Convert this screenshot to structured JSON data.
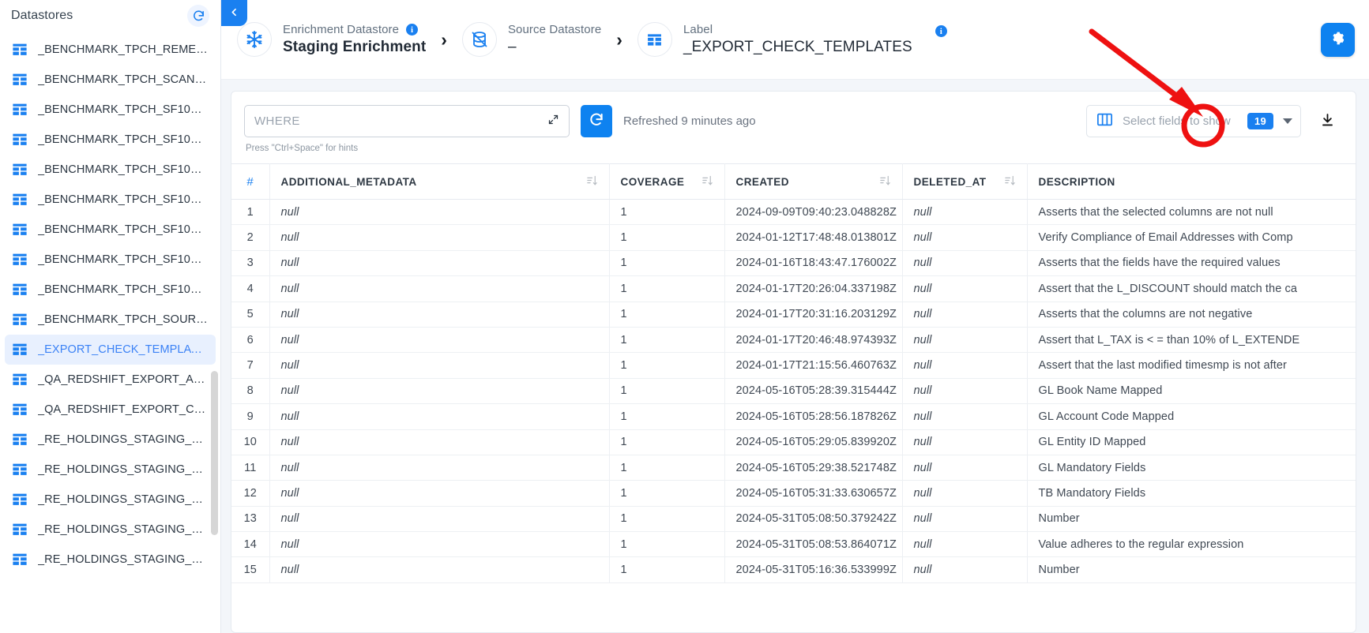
{
  "sidebar": {
    "title": "Datastores",
    "refresh_icon": "refresh-icon",
    "items": [
      {
        "label": "_BENCHMARK_TPCH_REME…",
        "icon": "table-icon",
        "active": false
      },
      {
        "label": "_BENCHMARK_TPCH_SCAN…",
        "icon": "table-icon",
        "active": false
      },
      {
        "label": "_BENCHMARK_TPCH_SF10_…",
        "icon": "table-icon",
        "active": false
      },
      {
        "label": "_BENCHMARK_TPCH_SF10_…",
        "icon": "table-icon",
        "active": false
      },
      {
        "label": "_BENCHMARK_TPCH_SF10_…",
        "icon": "table-icon",
        "active": false
      },
      {
        "label": "_BENCHMARK_TPCH_SF10_…",
        "icon": "table-icon",
        "active": false
      },
      {
        "label": "_BENCHMARK_TPCH_SF10_…",
        "icon": "table-icon",
        "active": false
      },
      {
        "label": "_BENCHMARK_TPCH_SF10_…",
        "icon": "table-icon",
        "active": false
      },
      {
        "label": "_BENCHMARK_TPCH_SF10_…",
        "icon": "table-icon",
        "active": false
      },
      {
        "label": "_BENCHMARK_TPCH_SOUR…",
        "icon": "table-icon",
        "active": false
      },
      {
        "label": "_EXPORT_CHECK_TEMPLAT…",
        "icon": "table-icon",
        "active": true
      },
      {
        "label": "_QA_REDSHIFT_EXPORT_A…",
        "icon": "table-icon",
        "active": false
      },
      {
        "label": "_QA_REDSHIFT_EXPORT_C…",
        "icon": "table-icon",
        "active": false
      },
      {
        "label": "_RE_HOLDINGS_STAGING_…",
        "icon": "table-icon",
        "active": false
      },
      {
        "label": "_RE_HOLDINGS_STAGING_…",
        "icon": "table-icon",
        "active": false
      },
      {
        "label": "_RE_HOLDINGS_STAGING_…",
        "icon": "table-icon",
        "active": false
      },
      {
        "label": "_RE_HOLDINGS_STAGING_…",
        "icon": "table-icon",
        "active": false
      },
      {
        "label": "_RE_HOLDINGS_STAGING_…",
        "icon": "table-icon",
        "active": false
      }
    ]
  },
  "header": {
    "collapse_icon": "chevron-left-icon",
    "gear_icon": "gear-icon",
    "breadcrumb": [
      {
        "kind": "Enrichment Datastore",
        "value": "Staging Enrichment",
        "icon": "snowflake-icon",
        "info": "i",
        "bold": true
      },
      {
        "kind": "Source Datastore",
        "value": "–",
        "icon": "database-off-icon",
        "info": "",
        "bold": false
      },
      {
        "kind": "Label",
        "value": "_EXPORT_CHECK_TEMPLATES",
        "icon": "table-icon",
        "info": "i",
        "bold": false
      }
    ],
    "separator": "›"
  },
  "toolbar": {
    "where_placeholder": "WHERE",
    "where_value": "",
    "expand_icon": "expand-icon",
    "hint": "Press \"Ctrl+Space\" for hints",
    "refresh_icon": "refresh-icon",
    "refreshed_text": "Refreshed 9 minutes ago",
    "fields_icon": "columns-icon",
    "fields_placeholder": "Select fields to show",
    "fields_count": "19",
    "caret_icon": "chevron-down-icon",
    "download_icon": "download-icon"
  },
  "table": {
    "columns": [
      {
        "key": "idx",
        "label": "#",
        "sortable": false
      },
      {
        "key": "meta",
        "label": "ADDITIONAL_METADATA",
        "sortable": true
      },
      {
        "key": "cov",
        "label": "COVERAGE",
        "sortable": true
      },
      {
        "key": "created",
        "label": "CREATED",
        "sortable": true
      },
      {
        "key": "del",
        "label": "DELETED_AT",
        "sortable": true
      },
      {
        "key": "desc",
        "label": "DESCRIPTION",
        "sortable": false
      }
    ],
    "rows": [
      {
        "idx": "1",
        "meta": "null",
        "cov": "1",
        "created": "2024-09-09T09:40:23.048828Z",
        "del": "null",
        "desc": "Asserts that the selected columns are not null"
      },
      {
        "idx": "2",
        "meta": "null",
        "cov": "1",
        "created": "2024-01-12T17:48:48.013801Z",
        "del": "null",
        "desc": "Verify Compliance of Email Addresses with Comp"
      },
      {
        "idx": "3",
        "meta": "null",
        "cov": "1",
        "created": "2024-01-16T18:43:47.176002Z",
        "del": "null",
        "desc": "Asserts that the fields have the required values"
      },
      {
        "idx": "4",
        "meta": "null",
        "cov": "1",
        "created": "2024-01-17T20:26:04.337198Z",
        "del": "null",
        "desc": "Assert that the L_DISCOUNT should match the ca"
      },
      {
        "idx": "5",
        "meta": "null",
        "cov": "1",
        "created": "2024-01-17T20:31:16.203129Z",
        "del": "null",
        "desc": "Asserts that the columns are not negative"
      },
      {
        "idx": "6",
        "meta": "null",
        "cov": "1",
        "created": "2024-01-17T20:46:48.974393Z",
        "del": "null",
        "desc": "Assert that L_TAX is < = than 10% of L_EXTENDE"
      },
      {
        "idx": "7",
        "meta": "null",
        "cov": "1",
        "created": "2024-01-17T21:15:56.460763Z",
        "del": "null",
        "desc": "Assert that the last modified timesmp is not after"
      },
      {
        "idx": "8",
        "meta": "null",
        "cov": "1",
        "created": "2024-05-16T05:28:39.315444Z",
        "del": "null",
        "desc": "GL Book Name Mapped"
      },
      {
        "idx": "9",
        "meta": "null",
        "cov": "1",
        "created": "2024-05-16T05:28:56.187826Z",
        "del": "null",
        "desc": "GL Account Code Mapped"
      },
      {
        "idx": "10",
        "meta": "null",
        "cov": "1",
        "created": "2024-05-16T05:29:05.839920Z",
        "del": "null",
        "desc": "GL Entity ID Mapped"
      },
      {
        "idx": "11",
        "meta": "null",
        "cov": "1",
        "created": "2024-05-16T05:29:38.521748Z",
        "del": "null",
        "desc": "GL Mandatory Fields"
      },
      {
        "idx": "12",
        "meta": "null",
        "cov": "1",
        "created": "2024-05-16T05:31:33.630657Z",
        "del": "null",
        "desc": "TB Mandatory Fields"
      },
      {
        "idx": "13",
        "meta": "null",
        "cov": "1",
        "created": "2024-05-31T05:08:50.379242Z",
        "del": "null",
        "desc": "Number"
      },
      {
        "idx": "14",
        "meta": "null",
        "cov": "1",
        "created": "2024-05-31T05:08:53.864071Z",
        "del": "null",
        "desc": "Value adheres to the regular expression"
      },
      {
        "idx": "15",
        "meta": "null",
        "cov": "1",
        "created": "2024-05-31T05:16:36.533999Z",
        "del": "null",
        "desc": "Number"
      }
    ]
  },
  "annotation": {
    "arrow_color": "#ee1111",
    "highlight_target": "download-button"
  },
  "colors": {
    "accent": "#1a80f0",
    "active_row": "#e8f0fe",
    "page_bg": "#f3f6fa"
  }
}
